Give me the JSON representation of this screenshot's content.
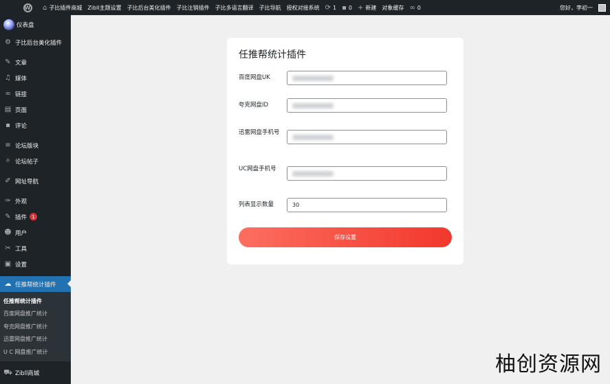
{
  "adminbar": {
    "items": [
      {
        "icon": "home-icon",
        "label": "子比插件商城"
      },
      {
        "label": "Zibll主题设置"
      },
      {
        "label": "子比后台美化插件"
      },
      {
        "label": "子比注销插件"
      },
      {
        "label": "子比多语言翻译"
      },
      {
        "label": "子比导航"
      },
      {
        "label": "授权对接系统"
      },
      {
        "icon": "updates-icon",
        "label": "1"
      },
      {
        "icon": "comment-icon",
        "label": "0"
      },
      {
        "icon": "plus-icon",
        "label": "新建"
      },
      {
        "label": "对象缓存"
      },
      {
        "icon": "link-icon",
        "label": "0"
      }
    ],
    "greeting": "您好，李初一"
  },
  "sidebar": {
    "items": [
      {
        "label": "仪表盘"
      },
      {
        "label": "子比后台美化插件"
      },
      {
        "label": "文章"
      },
      {
        "label": "媒体"
      },
      {
        "label": "链接"
      },
      {
        "label": "页面"
      },
      {
        "label": "评论"
      },
      {
        "label": "论坛版块"
      },
      {
        "label": "论坛帖子"
      },
      {
        "label": "网址导航"
      },
      {
        "label": "外观"
      },
      {
        "label": "插件",
        "badge": "1"
      },
      {
        "label": "用户"
      },
      {
        "label": "工具"
      },
      {
        "label": "设置"
      },
      {
        "label": "任推帮统计插件"
      },
      {
        "label": "Zibll商城"
      }
    ],
    "submenu": [
      {
        "label": "任推帮统计插件"
      },
      {
        "label": "百度网盘推广统计"
      },
      {
        "label": "夸克网盘推广统计"
      },
      {
        "label": "迅雷网盘推广统计"
      },
      {
        "label": "U C 网盘推广统计"
      }
    ]
  },
  "form": {
    "title": "任推帮统计插件",
    "fields": [
      {
        "label": "百度网盘UK",
        "value": ""
      },
      {
        "label": "夸克网盘ID",
        "value": ""
      },
      {
        "label": "迅雷网盘手机号",
        "value": ""
      },
      {
        "label": "UC网盘手机号",
        "value": ""
      },
      {
        "label": "列表显示数量",
        "value": "30"
      }
    ],
    "save_label": "保存设置"
  },
  "watermark": "柚创资源网",
  "colors": {
    "accent": "#2271b1",
    "button_start": "#fc6e5f",
    "button_end": "#f2382d",
    "badge": "#d63638"
  }
}
